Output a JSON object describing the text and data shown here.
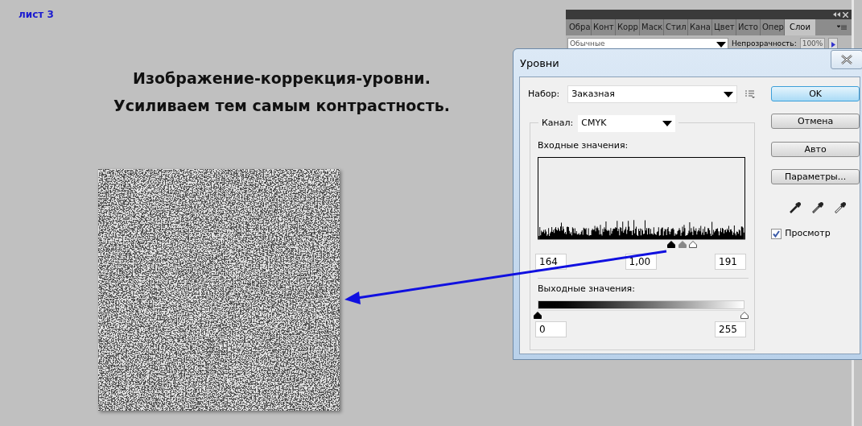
{
  "sheet_label": "лист 3",
  "heading_lines": [
    "Изображение-коррекция-уровни.",
    "Усиливаем тем самым контрастность."
  ],
  "layers_panel": {
    "tabs": [
      {
        "label": "Обра",
        "selected": false
      },
      {
        "label": "Конт",
        "selected": false
      },
      {
        "label": "Корр",
        "selected": false
      },
      {
        "label": "Маск",
        "selected": false
      },
      {
        "label": "Стил",
        "selected": false
      },
      {
        "label": "Кана",
        "selected": false
      },
      {
        "label": "Цвет",
        "selected": false
      },
      {
        "label": "Исто",
        "selected": false
      },
      {
        "label": "Опер",
        "selected": false
      },
      {
        "label": "Слои",
        "selected": true
      }
    ],
    "blend_mode": "Обычные",
    "opacity_label": "Непрозрачность:",
    "opacity_value": "100%"
  },
  "dialog": {
    "title": "Уровни",
    "preset_label": "Набор:",
    "preset_value": "Заказная",
    "channel_label": "Канал:",
    "channel_value": "CMYK",
    "input_label": "Входные значения:",
    "input_handles": [
      {
        "kind": "black",
        "level": 0.643
      },
      {
        "kind": "gray",
        "level": 0.696
      },
      {
        "kind": "white",
        "level": 0.749
      }
    ],
    "input_values": [
      "164",
      "1,00",
      "191"
    ],
    "output_label": "Выходные значения:",
    "output_handles": [
      {
        "kind": "black",
        "level": 0
      },
      {
        "kind": "white",
        "level": 1
      }
    ],
    "output_values": [
      "0",
      "255"
    ],
    "buttons": [
      {
        "label": "OK",
        "default": true
      },
      {
        "label": "Отмена",
        "default": false
      },
      {
        "label": "Авто",
        "default": false
      },
      {
        "label": "Параметры...",
        "default": false
      }
    ],
    "preview_label": "Просмотр",
    "preview_checked": true
  }
}
